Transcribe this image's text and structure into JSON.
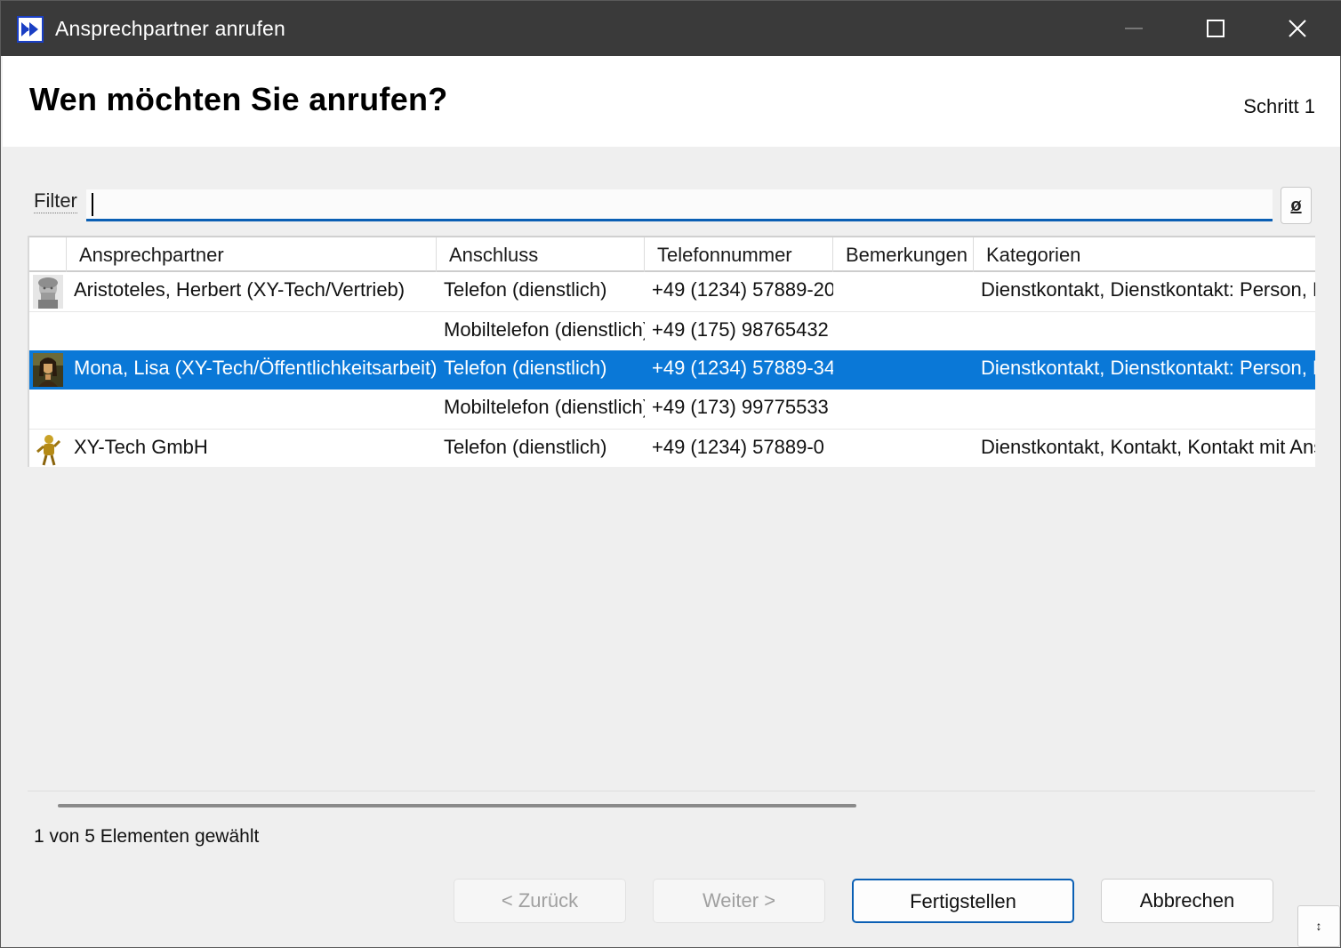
{
  "window": {
    "title": "Ansprechpartner anrufen",
    "controls": {
      "minimize": "minimize",
      "maximize": "maximize",
      "close": "close"
    }
  },
  "header": {
    "heading": "Wen möchten Sie anrufen?",
    "step": "Schritt 1"
  },
  "filter": {
    "label": "Filter",
    "value": "",
    "clear_label": "ø"
  },
  "grid": {
    "columns": [
      "Ansprechpartner",
      "Anschluss",
      "Telefonnummer",
      "Bemerkungen",
      "Kategorien"
    ],
    "rows": [
      {
        "contact": "Aristoteles, Herbert (XY-Tech/Vertrieb)",
        "connection": "Telefon (dienstlich)",
        "phone": "+49 (1234) 57889-20",
        "remarks": "",
        "categories": "Dienstkontakt, Dienstkontakt: Person, K",
        "avatar": "bust-statue-icon",
        "selected": false
      },
      {
        "contact": "",
        "connection": "Mobiltelefon (dienstlich)",
        "phone": "+49 (175) 98765432",
        "remarks": "",
        "categories": "",
        "avatar": "",
        "selected": false
      },
      {
        "contact": "Mona, Lisa (XY-Tech/Öffentlichkeitsarbeit)",
        "connection": "Telefon (dienstlich)",
        "phone": "+49 (1234) 57889-34",
        "remarks": "",
        "categories": "Dienstkontakt, Dienstkontakt: Person, K",
        "avatar": "mona-lisa-portrait-icon",
        "selected": true
      },
      {
        "contact": "",
        "connection": "Mobiltelefon (dienstlich)",
        "phone": "+49 (173) 99775533",
        "remarks": "",
        "categories": "",
        "avatar": "",
        "selected": false
      },
      {
        "contact": "XY-Tech GmbH",
        "connection": "Telefon (dienstlich)",
        "phone": "+49 (1234) 57889-0",
        "remarks": "",
        "categories": "Dienstkontakt, Kontakt, Kontakt mit Ans",
        "avatar": "golden-figure-icon",
        "selected": false
      }
    ]
  },
  "status": {
    "text": "1 von 5 Elementen gewählt"
  },
  "buttons": {
    "back": "< Zurück",
    "next": "Weiter >",
    "finish": "Fertigstellen",
    "cancel": "Abbrechen"
  },
  "colors": {
    "titlebar": "#3a3a3a",
    "selection": "#0a78d7",
    "accent": "#0a5fb4"
  }
}
